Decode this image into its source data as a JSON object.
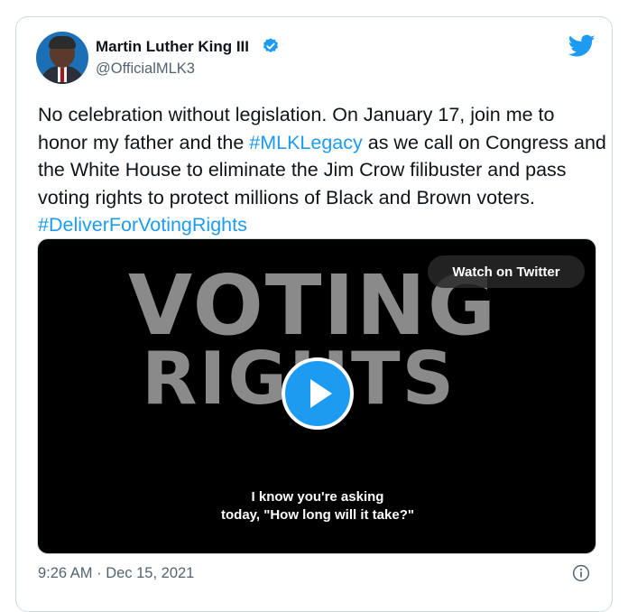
{
  "author": {
    "name": "Martin Luther King III",
    "handle": "@OfficialMLK3"
  },
  "tweet": {
    "text_1": "No celebration without legislation. On January 17, join me to honor my father and the ",
    "hashtag_1": "#MLKLegacy",
    "text_2": " as we call on Congress and the White House to eliminate the Jim Crow filibuster and pass voting rights to protect millions of Black and Brown voters. ",
    "hashtag_2": "#DeliverForVotingRights"
  },
  "media": {
    "title_line1": "VOTING",
    "title_line2": "RIGHTS",
    "watch_label": "Watch on Twitter",
    "caption_line1": "I know you're asking",
    "caption_line2": "today, \"How long will it take?\""
  },
  "meta": {
    "timestamp": "9:26 AM · Dec 15, 2021"
  },
  "icons": {
    "verified": "verified-badge-icon",
    "brand": "twitter-bird-icon",
    "play": "play-icon",
    "info": "info-icon"
  },
  "colors": {
    "accent": "#1d9bf0",
    "text": "#0f1419",
    "secondary": "#536471"
  }
}
